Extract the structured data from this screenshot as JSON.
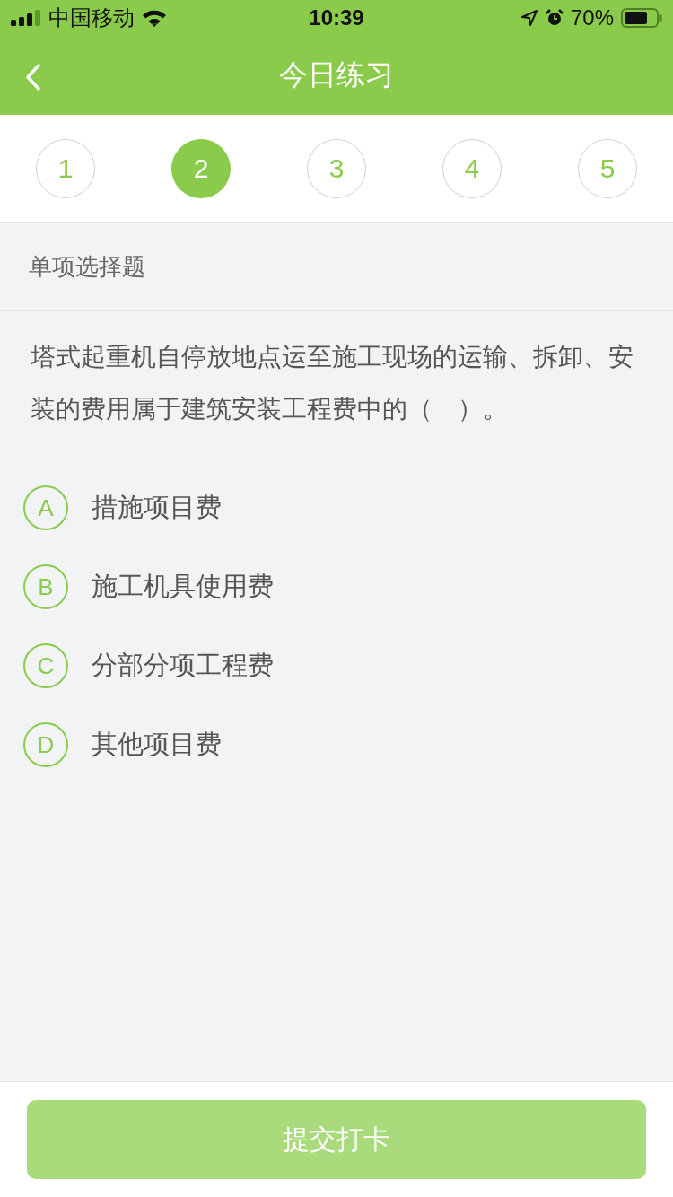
{
  "status_bar": {
    "carrier": "中国移动",
    "time": "10:39",
    "battery": "70%"
  },
  "nav": {
    "title": "今日练习"
  },
  "question_tabs": [
    {
      "label": "1",
      "selected": false
    },
    {
      "label": "2",
      "selected": true
    },
    {
      "label": "3",
      "selected": false
    },
    {
      "label": "4",
      "selected": false
    },
    {
      "label": "5",
      "selected": false
    }
  ],
  "section": {
    "title": "单项选择题"
  },
  "question": {
    "text": "塔式起重机自停放地点运至施工现场的运输、拆卸、安装的费用属于建筑安装工程费中的（　）。"
  },
  "options": [
    {
      "letter": "A",
      "text": "措施项目费",
      "selected": false
    },
    {
      "letter": "B",
      "text": "施工机具使用费",
      "selected": false
    },
    {
      "letter": "C",
      "text": "分部分项工程费",
      "selected": false
    },
    {
      "letter": "D",
      "text": "其他项目费",
      "selected": false
    }
  ],
  "submit": {
    "label": "提交打卡",
    "disabled": true
  }
}
